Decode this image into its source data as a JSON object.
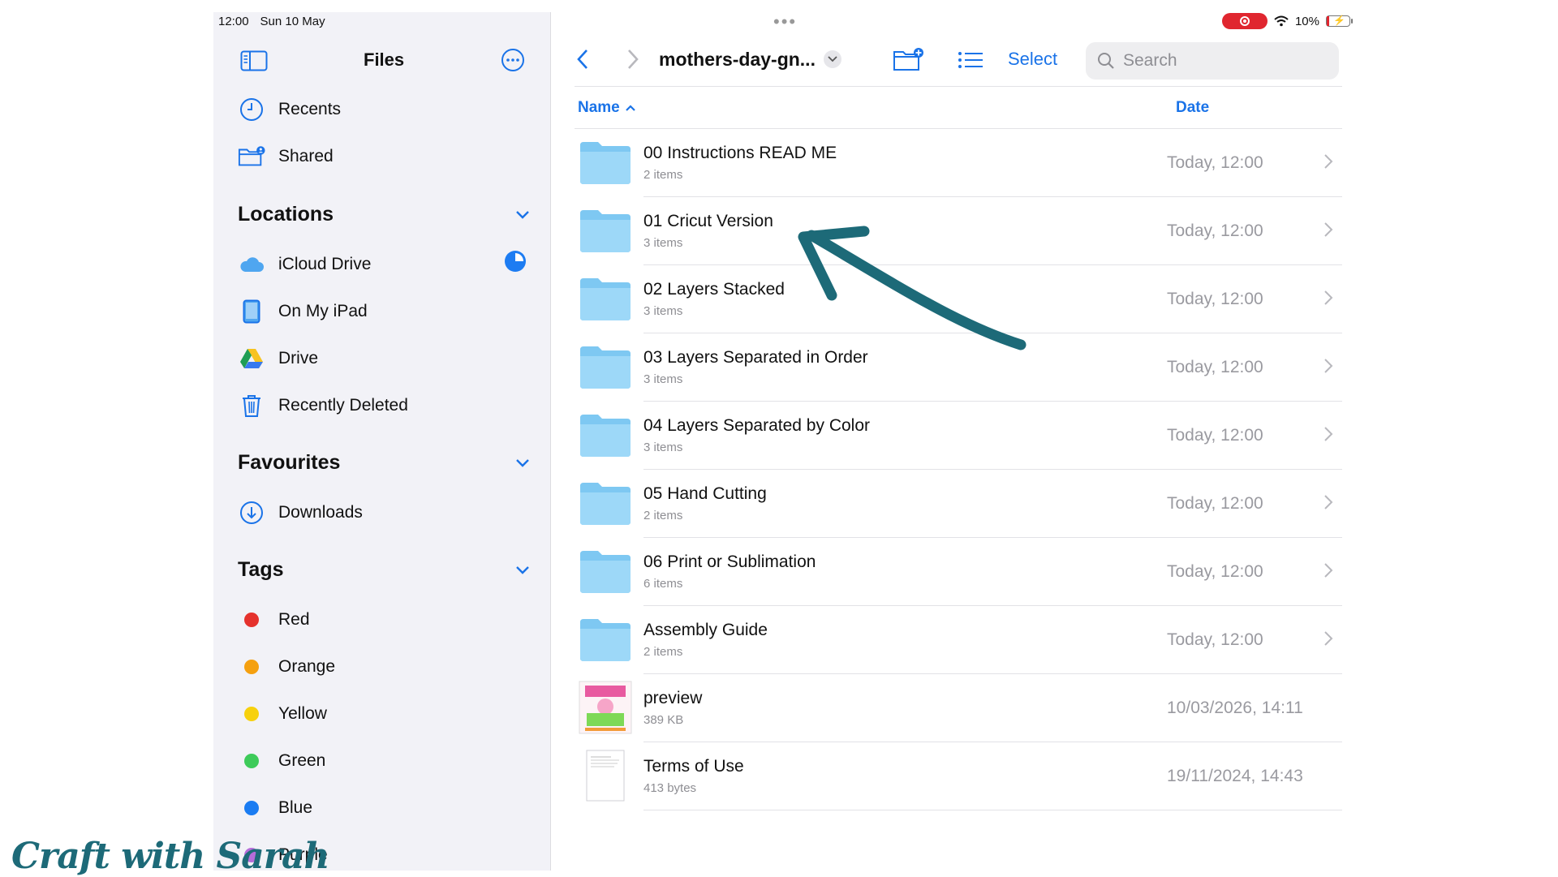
{
  "status": {
    "time": "12:00",
    "date": "Sun 10 May",
    "battery": "10%",
    "battery_fraction": 0.1
  },
  "sidebar": {
    "title": "Files",
    "items": [
      {
        "label": "Recents",
        "icon": "clock-icon"
      },
      {
        "label": "Shared",
        "icon": "shared-folder-icon"
      }
    ],
    "locations": {
      "title": "Locations",
      "items": [
        {
          "label": "iCloud Drive",
          "icon": "icloud-icon"
        },
        {
          "label": "On My iPad",
          "icon": "ipad-icon"
        },
        {
          "label": "Drive",
          "icon": "google-drive-icon"
        },
        {
          "label": "Recently Deleted",
          "icon": "trash-icon"
        }
      ]
    },
    "favourites": {
      "title": "Favourites",
      "items": [
        {
          "label": "Downloads",
          "icon": "download-icon"
        }
      ]
    },
    "tags": {
      "title": "Tags",
      "items": [
        {
          "label": "Red",
          "color": "#e5322d"
        },
        {
          "label": "Orange",
          "color": "#f5a00f"
        },
        {
          "label": "Yellow",
          "color": "#f7d10d"
        },
        {
          "label": "Green",
          "color": "#3ecb5a"
        },
        {
          "label": "Blue",
          "color": "#1a7cf2"
        },
        {
          "label": "Purple",
          "color": "#b56cd9"
        }
      ]
    }
  },
  "toolbar": {
    "folder_name": "mothers-day-gn...",
    "select_label": "Select",
    "search_placeholder": "Search"
  },
  "columns": {
    "name": "Name",
    "date": "Date"
  },
  "files": [
    {
      "name": "00 Instructions READ ME",
      "sub": "2 items",
      "date": "Today, 12:00",
      "kind": "folder"
    },
    {
      "name": "01 Cricut Version",
      "sub": "3 items",
      "date": "Today, 12:00",
      "kind": "folder"
    },
    {
      "name": "02 Layers Stacked",
      "sub": "3 items",
      "date": "Today, 12:00",
      "kind": "folder"
    },
    {
      "name": "03 Layers Separated in Order",
      "sub": "3 items",
      "date": "Today, 12:00",
      "kind": "folder"
    },
    {
      "name": "04 Layers Separated by Color",
      "sub": "3 items",
      "date": "Today, 12:00",
      "kind": "folder"
    },
    {
      "name": "05 Hand Cutting",
      "sub": "2 items",
      "date": "Today, 12:00",
      "kind": "folder"
    },
    {
      "name": "06 Print or Sublimation",
      "sub": "6 items",
      "date": "Today, 12:00",
      "kind": "folder"
    },
    {
      "name": "Assembly Guide",
      "sub": "2 items",
      "date": "Today, 12:00",
      "kind": "folder"
    },
    {
      "name": "preview",
      "sub": "389 KB",
      "date": "10/03/2026, 14:11",
      "kind": "image"
    },
    {
      "name": "Terms of Use",
      "sub": "413 bytes",
      "date": "19/11/2024, 14:43",
      "kind": "document"
    }
  ],
  "watermark": "Craft with Sarah",
  "colors": {
    "accent": "#1a73e8",
    "arrow": "#1d6a78",
    "folder": "#86d0f5"
  }
}
